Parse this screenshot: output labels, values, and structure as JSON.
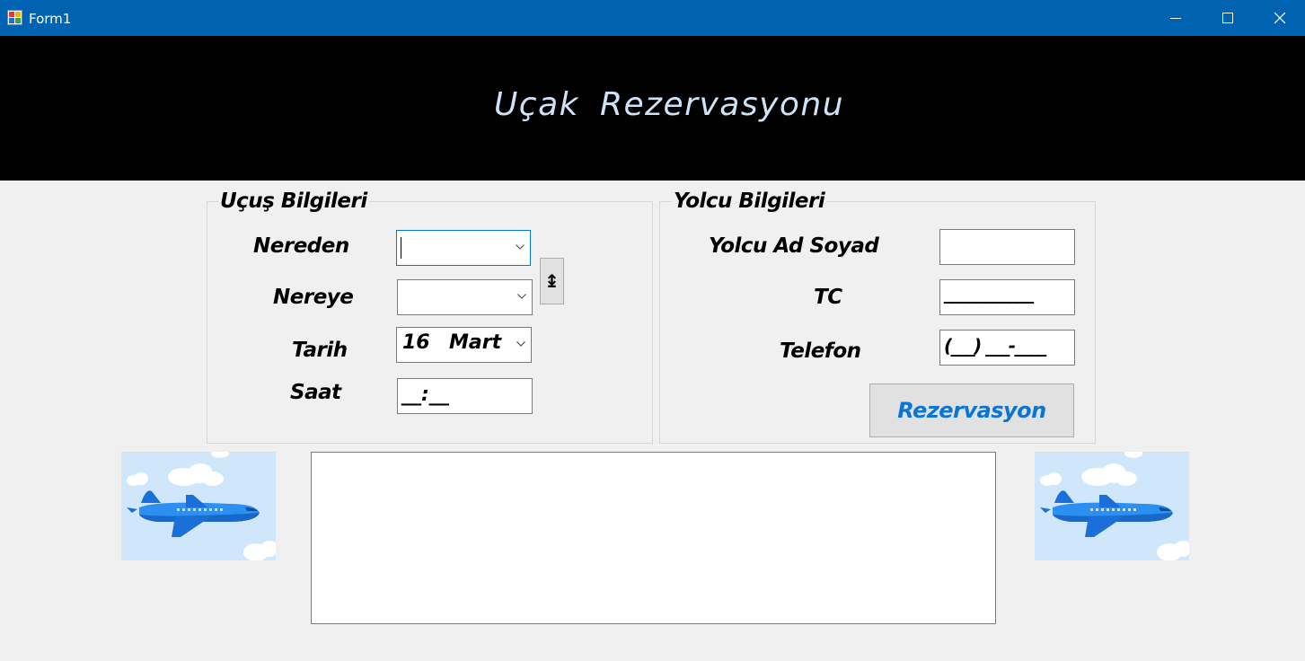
{
  "window": {
    "title": "Form1",
    "controls": [
      "minimize-icon",
      "maximize-icon",
      "close-icon"
    ]
  },
  "banner": {
    "title": "Uçak  Rezervasyonu",
    "background": "#000000",
    "text_color": "#cfe3f8"
  },
  "flight_group": {
    "title": "Uçuş Bilgileri",
    "from_label": "Nereden",
    "from_value": "",
    "to_label": "Nereye",
    "to_value": "",
    "swap_button": "↨",
    "date_label": "Tarih",
    "date_day": "16",
    "date_month": "Mart",
    "time_label": "Saat",
    "time_mask": "__:__"
  },
  "passenger_group": {
    "title": "Yolcu Bilgileri",
    "name_label": "Yolcu Ad Soyad",
    "name_value": "",
    "tc_label": "TC",
    "tc_mask": "___________",
    "phone_label": "Telefon",
    "phone_mask": "(___) ___-____",
    "reserve_button": "Rezervasyon"
  },
  "output": {
    "text": ""
  },
  "colors": {
    "titlebar": "#0063b1",
    "form_bg": "#f0f0f0",
    "accent_button_text": "#0a75d4",
    "sky": "#cfe6fb",
    "plane": "#2d8ff0"
  },
  "icons": {
    "app": "app-icon",
    "dropdown": "chevron-down-icon",
    "picture": "airplane-illustration"
  }
}
